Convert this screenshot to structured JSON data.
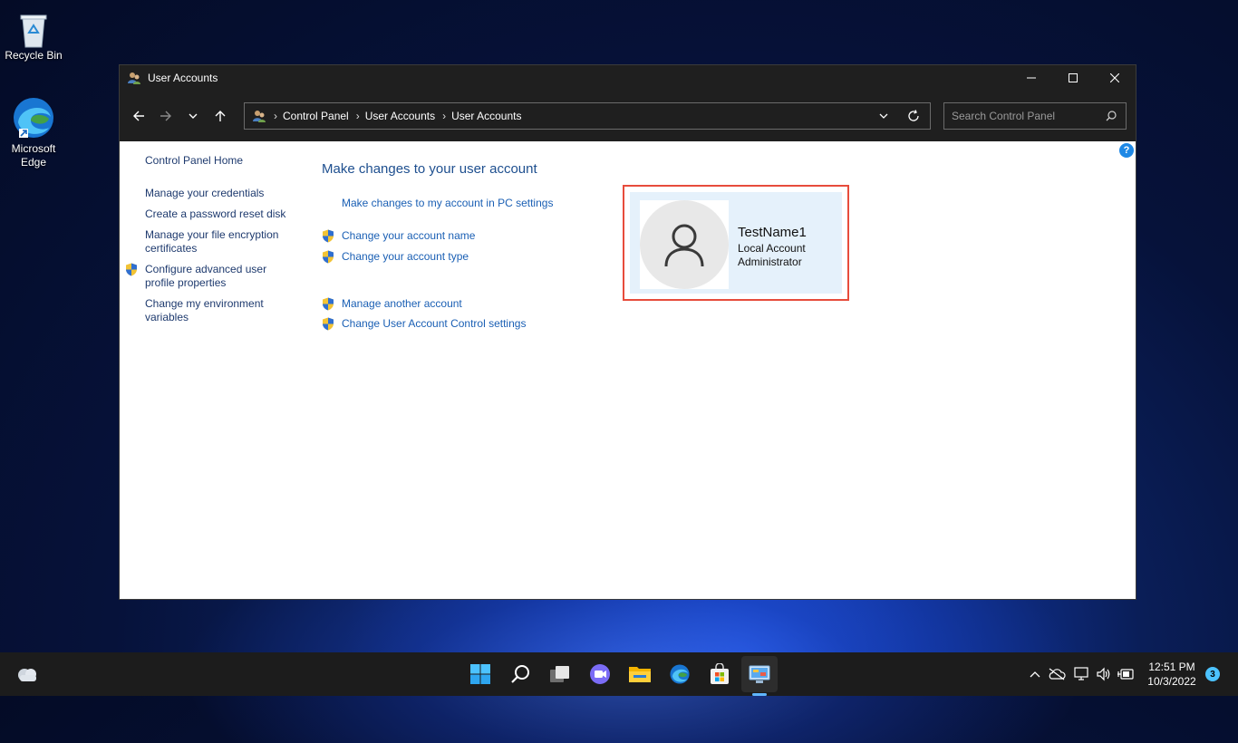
{
  "desktop": {
    "icons": [
      {
        "label": "Recycle Bin",
        "icon": "recycle-bin-icon"
      },
      {
        "label": "Microsoft Edge",
        "icon": "edge-icon"
      }
    ]
  },
  "window": {
    "title": "User Accounts",
    "controls": {
      "minimize": "minimize-icon",
      "maximize": "maximize-icon",
      "close": "close-icon"
    }
  },
  "navigation": {
    "breadcrumb": [
      "Control Panel",
      "User Accounts",
      "User Accounts"
    ],
    "search_placeholder": "Search Control Panel"
  },
  "left_nav": {
    "items": [
      {
        "label": "Control Panel Home",
        "shield": false
      },
      {
        "label": "Manage your credentials",
        "shield": false
      },
      {
        "label": "Create a password reset disk",
        "shield": false
      },
      {
        "label": "Manage your file encryption certificates",
        "shield": false
      },
      {
        "label": "Configure advanced user profile properties",
        "shield": true
      },
      {
        "label": "Change my environment variables",
        "shield": false
      }
    ]
  },
  "main": {
    "title": "Make changes to your user account",
    "tasks": [
      {
        "label": "Make changes to my account in PC settings",
        "shield": false
      },
      {
        "label": "Change your account name",
        "shield": true
      },
      {
        "label": "Change your account type",
        "shield": true
      },
      {
        "label": "Manage another account",
        "shield": true
      },
      {
        "label": "Change User Account Control settings",
        "shield": true
      }
    ]
  },
  "user": {
    "name": "TestName1",
    "account_type": "Local Account",
    "role": "Administrator"
  },
  "taskbar": {
    "apps": [
      "start-icon",
      "search-icon",
      "task-view-icon",
      "chat-icon",
      "file-explorer-icon",
      "edge-icon",
      "store-icon",
      "control-panel-icon"
    ],
    "clock_time": "12:51 PM",
    "clock_date": "10/3/2022",
    "notification_count": "3"
  },
  "colors": {
    "link": "#1a5fb4",
    "highlight_border": "#e74c3c",
    "card_bg": "#e5f1fb",
    "titlebar": "#1f1f1f"
  }
}
